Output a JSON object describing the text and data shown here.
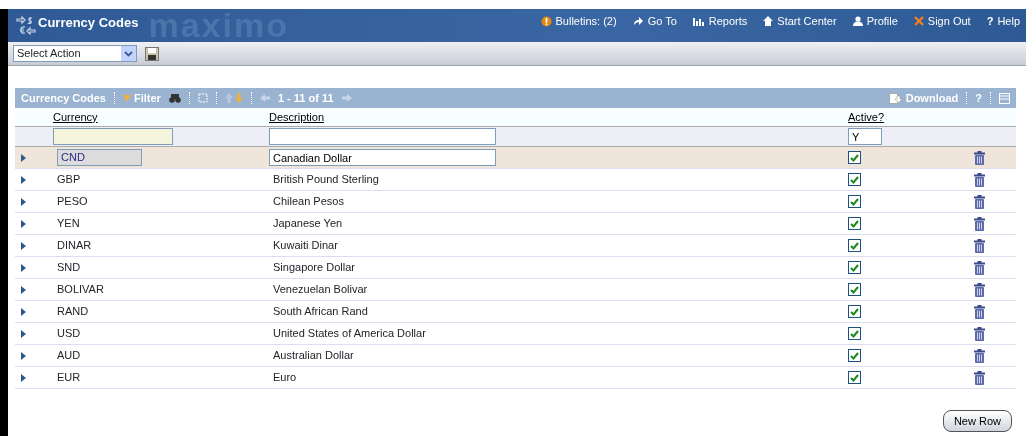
{
  "header": {
    "title": "Currency Codes",
    "logo_text": "maximo",
    "links": [
      {
        "kind": "bulletins",
        "label": "Bulletins: (2)"
      },
      {
        "kind": "goto",
        "label": "Go To"
      },
      {
        "kind": "reports",
        "label": "Reports"
      },
      {
        "kind": "start",
        "label": "Start Center"
      },
      {
        "kind": "profile",
        "label": "Profile"
      },
      {
        "kind": "signout",
        "label": "Sign Out"
      },
      {
        "kind": "help",
        "icon_text": "?",
        "label": "Help"
      }
    ]
  },
  "toolbar": {
    "action_select": "Select Action"
  },
  "table": {
    "title": "Currency Codes",
    "filter_label": "Filter",
    "paging": "1 - 11 of 11",
    "download_label": "Download",
    "help_label": "?",
    "columns": [
      "Currency",
      "Description",
      "Active?"
    ],
    "filter_row": {
      "active": "Y"
    },
    "rows": [
      {
        "currency": "CND",
        "description": "Canadian Dollar",
        "active": true,
        "selected": true
      },
      {
        "currency": "GBP",
        "description": "British Pound Sterling",
        "active": true,
        "selected": false
      },
      {
        "currency": "PESO",
        "description": "Chilean Pesos",
        "active": true,
        "selected": false
      },
      {
        "currency": "YEN",
        "description": "Japanese Yen",
        "active": true,
        "selected": false
      },
      {
        "currency": "DINAR",
        "description": "Kuwaiti Dinar",
        "active": true,
        "selected": false
      },
      {
        "currency": "SND",
        "description": "Singapore Dollar",
        "active": true,
        "selected": false
      },
      {
        "currency": "BOLIVAR",
        "description": "Venezuelan Bolivar",
        "active": true,
        "selected": false
      },
      {
        "currency": "RAND",
        "description": "South African Rand",
        "active": true,
        "selected": false
      },
      {
        "currency": "USD",
        "description": "United States of America Dollar",
        "active": true,
        "selected": false
      },
      {
        "currency": "AUD",
        "description": "Australian Dollar",
        "active": true,
        "selected": false
      },
      {
        "currency": "EUR",
        "description": "Euro",
        "active": true,
        "selected": false
      }
    ],
    "new_row_button": "New Row"
  }
}
